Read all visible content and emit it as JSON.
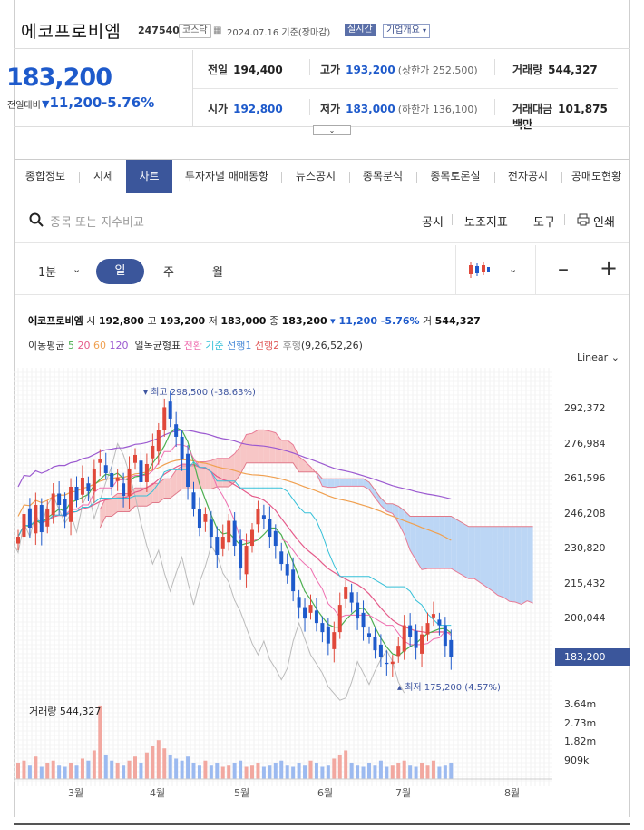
{
  "header": {
    "name": "에코프로비엠",
    "code": "247540",
    "market": "코스닥",
    "date": "2024.07.16 기준(장마감)",
    "realtime": "실시간",
    "corp_info": "기업개요"
  },
  "price": {
    "current": "183,200",
    "change_label": "전일대비",
    "change_value": "11,200",
    "change_pct": "-5.76%"
  },
  "quote": {
    "prev": {
      "label": "전일",
      "value": "194,400"
    },
    "high": {
      "label": "고가",
      "value": "193,200",
      "sub": "(상한가 252,500)"
    },
    "volume": {
      "label": "거래량",
      "value": "544,327"
    },
    "open": {
      "label": "시가",
      "value": "192,800"
    },
    "low": {
      "label": "저가",
      "value": "183,000",
      "sub": "(하한가 136,100)"
    },
    "amount": {
      "label": "거래대금",
      "value": "101,875 백만"
    }
  },
  "tabs": [
    "종합정보",
    "시세",
    "차트",
    "투자자별 매매동향",
    "뉴스공시",
    "종목분석",
    "종목토론실",
    "전자공시",
    "공매도현황"
  ],
  "toolbar": {
    "search_placeholder": "종목 또는 지수비교",
    "disclosure": "공시",
    "indicator": "보조지표",
    "tools": "도구",
    "print": "인쇄"
  },
  "periods": {
    "minute": "1분",
    "day": "일",
    "week": "주",
    "month": "월"
  },
  "chart_info": {
    "name": "에코프로비엠",
    "open_lbl": "시",
    "open": "192,800",
    "high_lbl": "고",
    "high": "193,200",
    "low_lbl": "저",
    "low": "183,000",
    "close_lbl": "종",
    "close": "183,200",
    "change": "▾ 11,200 -5.76%",
    "vol_lbl": "거",
    "vol": "544,327",
    "ma_title": "이동평균",
    "ma5": "5",
    "ma20": "20",
    "ma60": "60",
    "ma120": "120",
    "ich_title": "일목균형표",
    "ich1": "전환",
    "ich2": "기준",
    "ich3": "선행1",
    "ich4": "선행2",
    "ich5": "후행",
    "ich_params": "(9,26,52,26)",
    "scale": "Linear",
    "last_price": "183,200",
    "high_marker": "▾ 최고 298,500 (-38.63%)",
    "low_marker": "▴ 최저 175,200 (4.57%)",
    "volume_title": "거래량 544,327"
  },
  "colors": {
    "accent": "#3b569b",
    "down": "#1e5acb",
    "up": "#e0483a"
  },
  "chart_data": {
    "type": "candlestick",
    "y_ticks": [
      292372,
      276984,
      261596,
      246208,
      230820,
      215432,
      200044
    ],
    "ylim": [
      177000,
      303000
    ],
    "vol_ticks": [
      "3.64m",
      "2.73m",
      "1.82m",
      "909k"
    ],
    "months": [
      "3월",
      "4월",
      "5월",
      "6월",
      "7월",
      "8월"
    ],
    "close": [
      236000,
      246000,
      240000,
      250000,
      238000,
      248000,
      255000,
      250000,
      245000,
      258000,
      252000,
      262000,
      256000,
      266000,
      270000,
      264000,
      258000,
      262000,
      254000,
      266000,
      272000,
      260000,
      268000,
      276000,
      283000,
      293000,
      288000,
      280000,
      270000,
      258000,
      248000,
      240000,
      246000,
      236000,
      228000,
      236000,
      243000,
      232000,
      222000,
      232000,
      239000,
      248000,
      244000,
      236000,
      232000,
      224000,
      219000,
      212000,
      205000,
      200000,
      206000,
      198000,
      194000,
      189000,
      194000,
      206000,
      214000,
      207000,
      200000,
      196000,
      192000,
      186000,
      183000,
      180000,
      181000,
      188000,
      197000,
      192000,
      187000,
      193000,
      198000,
      202000,
      197000,
      188000,
      183200
    ],
    "volume": [
      0.8,
      0.9,
      0.7,
      1.1,
      0.6,
      0.8,
      0.9,
      0.7,
      0.6,
      0.8,
      0.7,
      1.0,
      0.9,
      1.4,
      3.6,
      1.2,
      0.9,
      0.8,
      0.7,
      0.9,
      1.1,
      0.8,
      1.3,
      1.6,
      1.9,
      1.5,
      1.2,
      1.0,
      0.9,
      1.1,
      0.8,
      0.7,
      0.9,
      0.7,
      0.8,
      0.6,
      0.7,
      0.8,
      0.9,
      0.6,
      0.7,
      0.8,
      0.6,
      0.7,
      0.8,
      0.9,
      0.7,
      0.6,
      0.8,
      0.7,
      0.9,
      0.8,
      0.6,
      0.7,
      1.0,
      1.2,
      1.4,
      0.8,
      0.7,
      0.6,
      0.8,
      0.7,
      0.9,
      0.6,
      0.7,
      0.8,
      0.9,
      0.7,
      0.6,
      0.8,
      0.7,
      0.9,
      0.6,
      0.7,
      0.8
    ]
  }
}
